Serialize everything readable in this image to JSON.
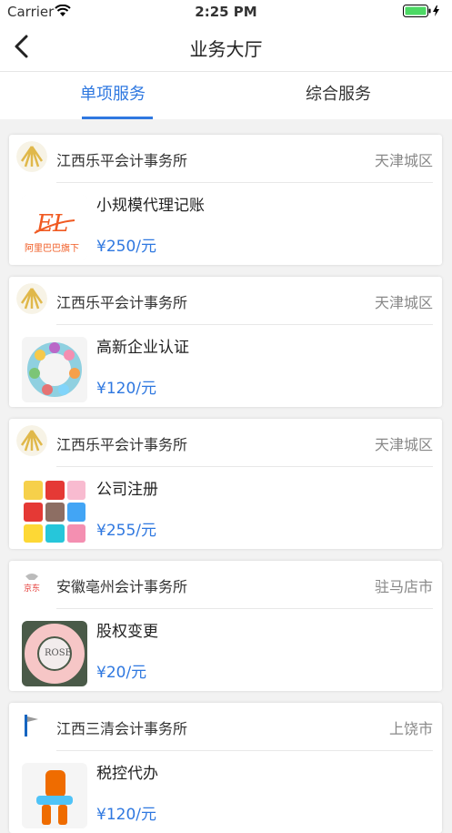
{
  "status_bar": {
    "carrier": "Carrier",
    "time": "2:25 PM"
  },
  "nav": {
    "title": "业务大厅"
  },
  "tabs": [
    {
      "label": "单项服务",
      "active": true
    },
    {
      "label": "综合服务",
      "active": false
    }
  ],
  "colors": {
    "accent": "#2f78e0",
    "background": "#f2f2f2",
    "battery": "#4cd964"
  },
  "items": [
    {
      "org": "江西乐平会计事务所",
      "area": "天津城区",
      "service": "小规模代理记账",
      "price": "¥250/元",
      "logo_icon": "sunburst-logo-icon",
      "thumb_icon": "alibaba-ad-icon",
      "thumb_text": "阿里巴巴旗下"
    },
    {
      "org": "江西乐平会计事务所",
      "area": "天津城区",
      "service": "高新企业认证",
      "price": "¥120/元",
      "logo_icon": "sunburst-logo-icon",
      "thumb_icon": "toy-wreath-icon"
    },
    {
      "org": "江西乐平会计事务所",
      "area": "天津城区",
      "service": "公司注册",
      "price": "¥255/元",
      "logo_icon": "sunburst-logo-icon",
      "thumb_icon": "animal-tiles-icon"
    },
    {
      "org": "安徽亳州会计事务所",
      "area": "驻马店市",
      "service": "股权变更",
      "price": "¥20/元",
      "logo_icon": "jd-logo-icon",
      "logo_text": "京东",
      "thumb_icon": "rose-wreath-icon",
      "thumb_text": "ROSE"
    },
    {
      "org": "江西三清会计事务所",
      "area": "上饶市",
      "service": "税控代办",
      "price": "¥120/元",
      "logo_icon": "flag-logo-icon",
      "thumb_icon": "toy-figure-icon"
    }
  ]
}
